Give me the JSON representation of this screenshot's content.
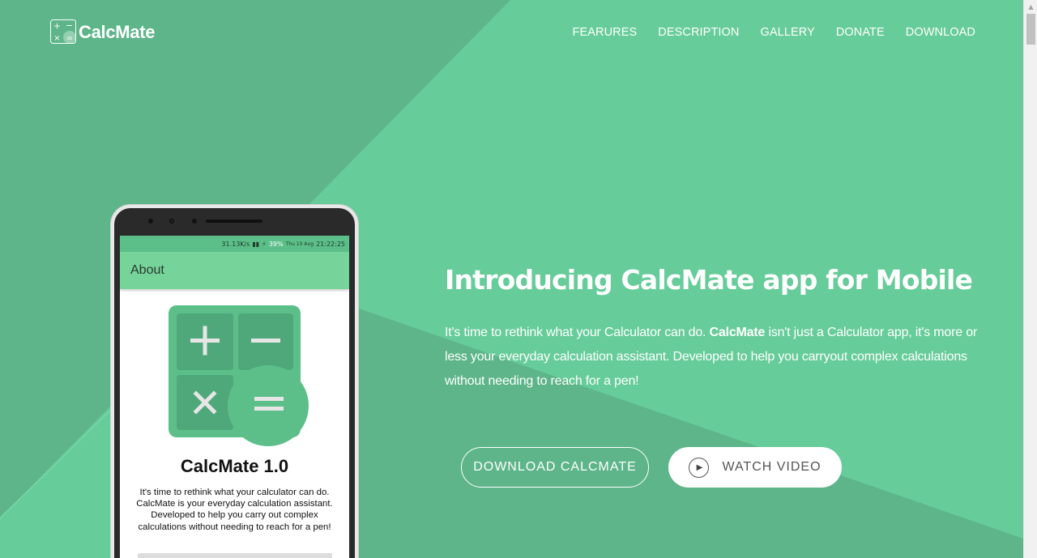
{
  "brand": {
    "name": "CalcMate"
  },
  "nav": {
    "items": [
      {
        "label": "FEARURES"
      },
      {
        "label": "DESCRIPTION"
      },
      {
        "label": "GALLERY"
      },
      {
        "label": "DONATE"
      },
      {
        "label": "DOWNLOAD"
      }
    ]
  },
  "hero": {
    "title": "Introducing CalcMate app for Mobile",
    "desc_before": "It's time to rethink what your Calculator can do. ",
    "desc_bold": "CalcMate",
    "desc_after": " isn't just a Calculator app, it's more or less your everyday calculation assistant. Developed to help you carryout complex calculations without needing to reach for a pen!",
    "download_label": "DOWNLOAD CALCMATE",
    "video_label": "WATCH VIDEO"
  },
  "phone": {
    "status": {
      "speed": "31.13K/s",
      "battery": "39%",
      "date": "Thu 10 Aug",
      "time": "21:22:25"
    },
    "appbar_title": "About",
    "app_title": "CalcMate 1.0",
    "app_desc": "It's time to rethink what your calculator can do. CalcMate is your everyday calculation assistant. Developed to help you carry out complex calculations without needing to reach for a pen!"
  },
  "colors": {
    "background": "#66cc99",
    "dark_stripe": "#5db589",
    "brand_green": "#5cbf89"
  }
}
